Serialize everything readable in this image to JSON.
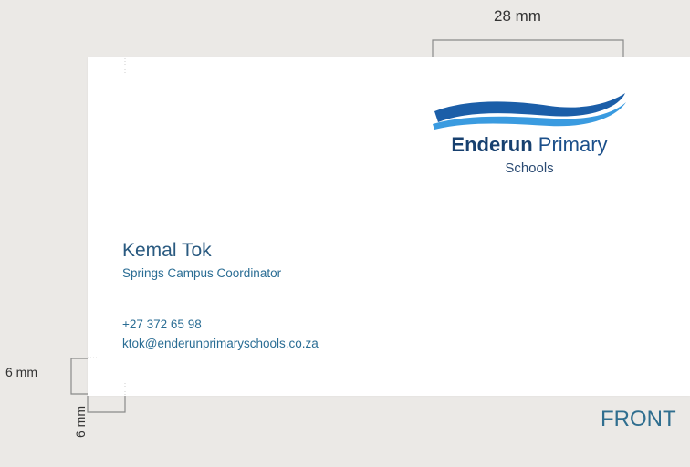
{
  "dimensions": {
    "top": "28 mm",
    "left": "6 mm",
    "bottom": "6 mm"
  },
  "logo": {
    "name_bold": "Enderun",
    "name_regular": "Primary",
    "subtitle": "Schools",
    "colors": {
      "wave_dark": "#1b5ea8",
      "wave_light": "#3a9be0",
      "text": "#1b4f8a"
    }
  },
  "contact": {
    "name": "Kemal Tok",
    "title": "Springs Campus Coordinator",
    "phone": "+27 372 65 98",
    "email": "ktok@enderunprimaryschools.co.za"
  },
  "side_label": "FRONT",
  "colors": {
    "background": "#ebe9e6",
    "card": "#ffffff",
    "accent": "#2a6d94"
  }
}
